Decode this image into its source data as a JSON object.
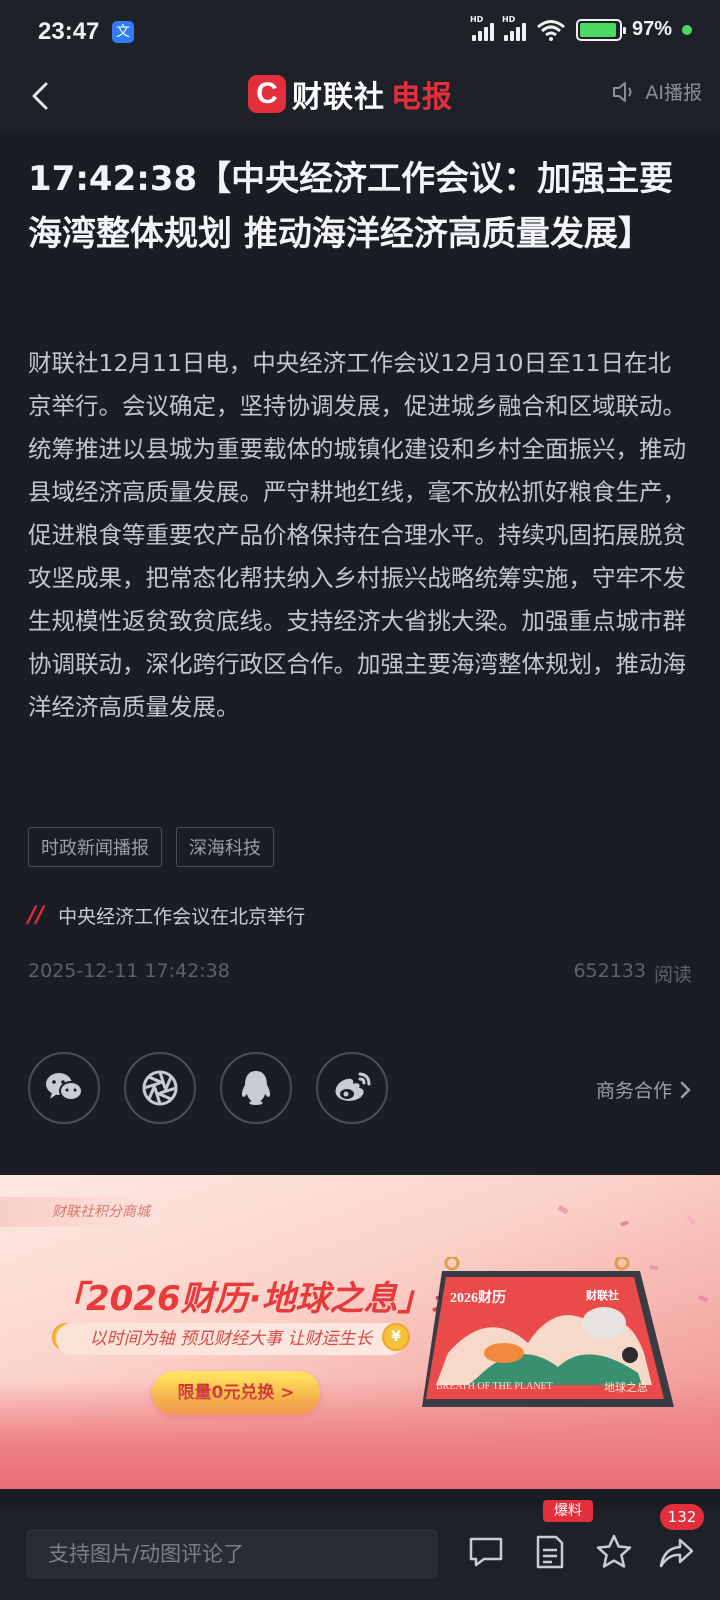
{
  "status_bar": {
    "time": "23:47",
    "app_icon_glyph": "文",
    "hd": "HD",
    "battery": "97%"
  },
  "header": {
    "logo_mark": "C",
    "logo_name": "财联社",
    "logo_product": "电报",
    "ai_button": "AI播报"
  },
  "article": {
    "title": "17:42:38【中央经济工作会议：加强主要海湾整体规划 推动海洋经济高质量发展】",
    "body": "财联社12月11日电，中央经济工作会议12月10日至11日在北京举行。会议确定，坚持协调发展，促进城乡融合和区域联动。统筹推进以县城为重要载体的城镇化建设和乡村全面振兴，推动县域经济高质量发展。严守耕地红线，毫不放松抓好粮食生产，促进粮食等重要农产品价格保持在合理水平。持续巩固拓展脱贫攻坚成果，把常态化帮扶纳入乡村振兴战略统筹实施，守牢不发生规模性返贫致贫底线。支持经济大省挑大梁。加强重点城市群协调联动，深化跨行政区合作。加强主要海湾整体规划，推动海洋经济高质量发展。",
    "tags": [
      "时政新闻播报",
      "深海科技"
    ],
    "topic_mark": "//",
    "topic": "中央经济工作会议在北京举行",
    "date": "2025-12-11 17:42:38",
    "read_count": "652133",
    "read_label": "阅读",
    "share_icons": [
      "wechat-icon",
      "moments-icon",
      "qq-icon",
      "weibo-icon"
    ],
    "business": "商务合作"
  },
  "banner": {
    "shop_label": "财联社积分商城",
    "headline": "「2026财历·地球之息」来了",
    "subline": "以时间为轴 预见财经大事 让财运生长",
    "coin_glyph": "¥",
    "cta": "限量0元兑换 >",
    "calendar_year": "2026财历",
    "calendar_brand": "财联社",
    "calendar_motto": "BREATH OF THE PLANET",
    "calendar_cn": "地球之息"
  },
  "composer": {
    "placeholder": "支持图片/动图评论了",
    "report_badge": "爆料",
    "share_count": "132"
  },
  "colors": {
    "brand_red": "#e32e3b",
    "background": "#1b1d24",
    "bar": "#1f2129"
  }
}
